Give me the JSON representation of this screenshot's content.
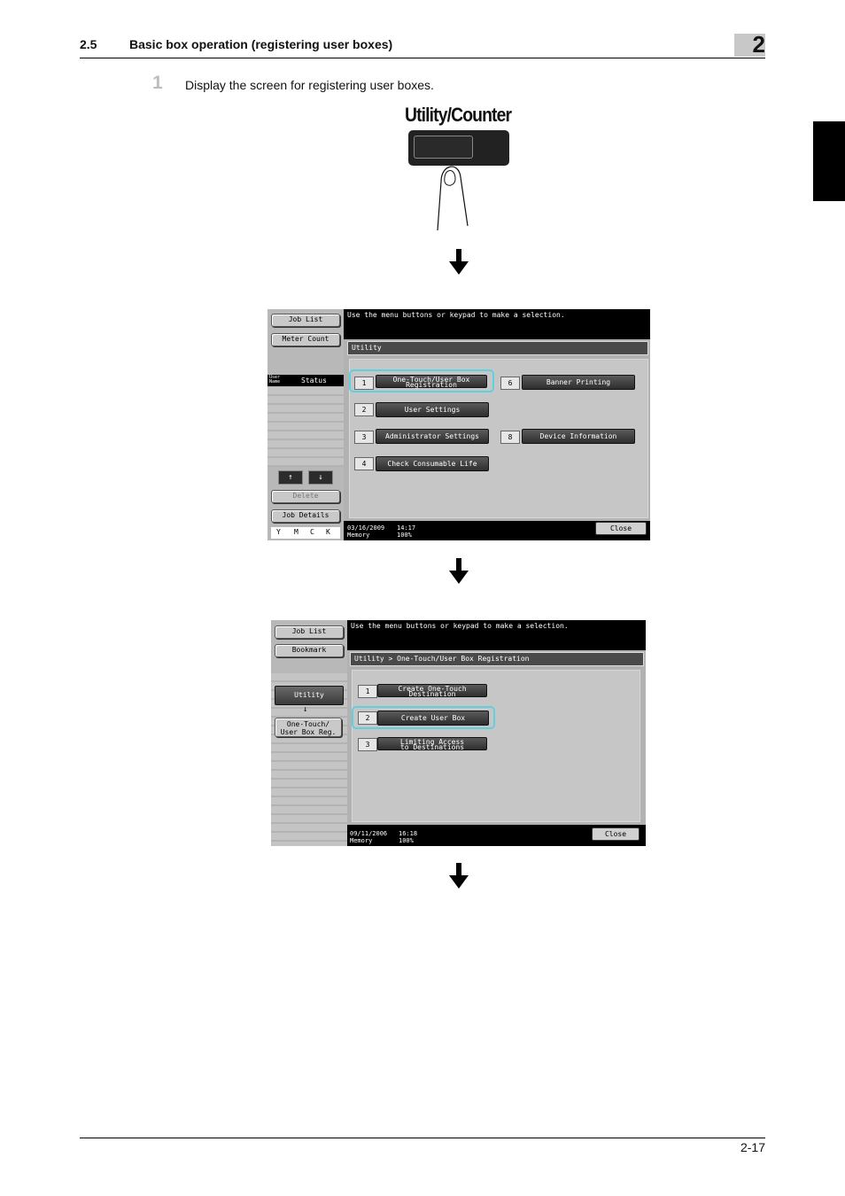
{
  "header": {
    "section": "2.5",
    "title": "Basic box operation (registering user boxes)",
    "chapter": "2"
  },
  "step": {
    "number": "1",
    "text": "Display the screen for registering user boxes."
  },
  "panel": {
    "label": "Utility/Counter"
  },
  "screen1": {
    "left": {
      "job_list": "Job List",
      "meter_count": "Meter Count",
      "user_name": "User Name",
      "status": "Status",
      "delete": "Delete",
      "job_details": "Job Details",
      "toner": [
        "Y",
        "M",
        "C",
        "K"
      ]
    },
    "message": "Use the menu buttons or keypad to make a selection.",
    "title": "Utility",
    "items": [
      {
        "num": "1",
        "label_l1": "One-Touch/User Box",
        "label_l2": "Registration"
      },
      {
        "num": "2",
        "label": "User Settings"
      },
      {
        "num": "3",
        "label": "Administrator Settings"
      },
      {
        "num": "4",
        "label": "Check Consumable Life"
      },
      {
        "num": "6",
        "label": "Banner Printing"
      },
      {
        "num": "8",
        "label": "Device Information"
      }
    ],
    "date": "03/16/2009",
    "time": "14:17",
    "memory_label": "Memory",
    "memory_value": "100%",
    "close": "Close"
  },
  "screen2": {
    "left": {
      "job_list": "Job List",
      "bookmark": "Bookmark",
      "utility": "Utility",
      "down_arrow": "↓",
      "sub_l1": "One-Touch/",
      "sub_l2": "User Box Reg."
    },
    "message": "Use the menu buttons or keypad to make a selection.",
    "title": "Utility > One-Touch/User Box Registration",
    "items": [
      {
        "num": "1",
        "label_l1": "Create One-Touch",
        "label_l2": "Destination"
      },
      {
        "num": "2",
        "label": "Create User Box"
      },
      {
        "num": "3",
        "label_l1": "Limiting Access",
        "label_l2": "to Destinations"
      }
    ],
    "date": "09/11/2006",
    "time": "16:18",
    "memory_label": "Memory",
    "memory_value": "100%",
    "close": "Close"
  },
  "footer": {
    "page": "2-17"
  }
}
